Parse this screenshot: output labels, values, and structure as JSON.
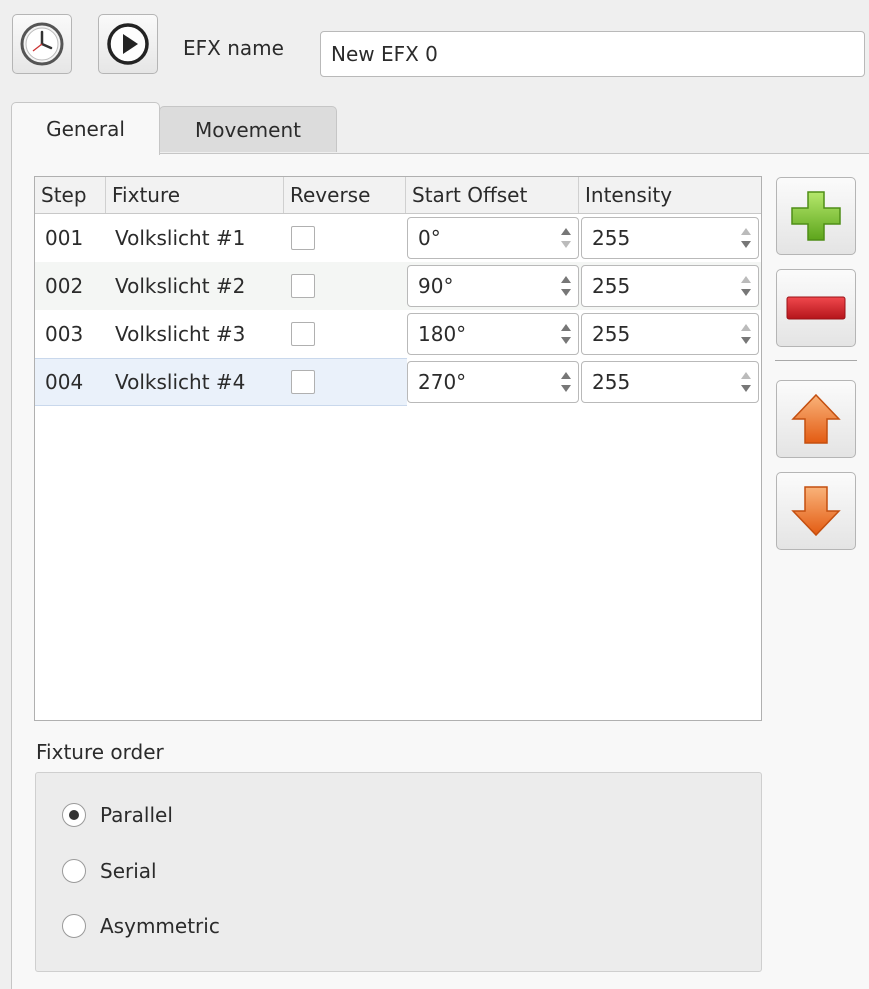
{
  "toolbar": {
    "clock_icon": "clock-icon",
    "play_icon": "play-icon",
    "name_label": "EFX name",
    "name_value": "New EFX 0"
  },
  "tabs": [
    {
      "label": "General",
      "active": true
    },
    {
      "label": "Movement",
      "active": false
    }
  ],
  "table": {
    "headers": [
      "Step",
      "Fixture",
      "Reverse",
      "Start Offset",
      "Intensity"
    ],
    "rows": [
      {
        "step": "001",
        "fixture": "Volkslicht #1",
        "reverse": false,
        "offset": "0°",
        "intensity": "255"
      },
      {
        "step": "002",
        "fixture": "Volkslicht #2",
        "reverse": false,
        "offset": "90°",
        "intensity": "255"
      },
      {
        "step": "003",
        "fixture": "Volkslicht #3",
        "reverse": false,
        "offset": "180°",
        "intensity": "255"
      },
      {
        "step": "004",
        "fixture": "Volkslicht #4",
        "reverse": false,
        "offset": "270°",
        "intensity": "255"
      }
    ],
    "selected_row": 3
  },
  "side_buttons": [
    {
      "icon": "add-icon"
    },
    {
      "icon": "remove-icon"
    },
    {
      "icon": "arrow-up-icon"
    },
    {
      "icon": "arrow-down-icon"
    }
  ],
  "fixture_order": {
    "title": "Fixture order",
    "options": [
      "Parallel",
      "Serial",
      "Asymmetric"
    ],
    "selected": "Parallel"
  },
  "colors": {
    "add_green": "#7cc52b",
    "remove_red": "#d8262d",
    "arrow_orange": "#f07a2a",
    "selected_row_bg": "#eaf1fa"
  }
}
